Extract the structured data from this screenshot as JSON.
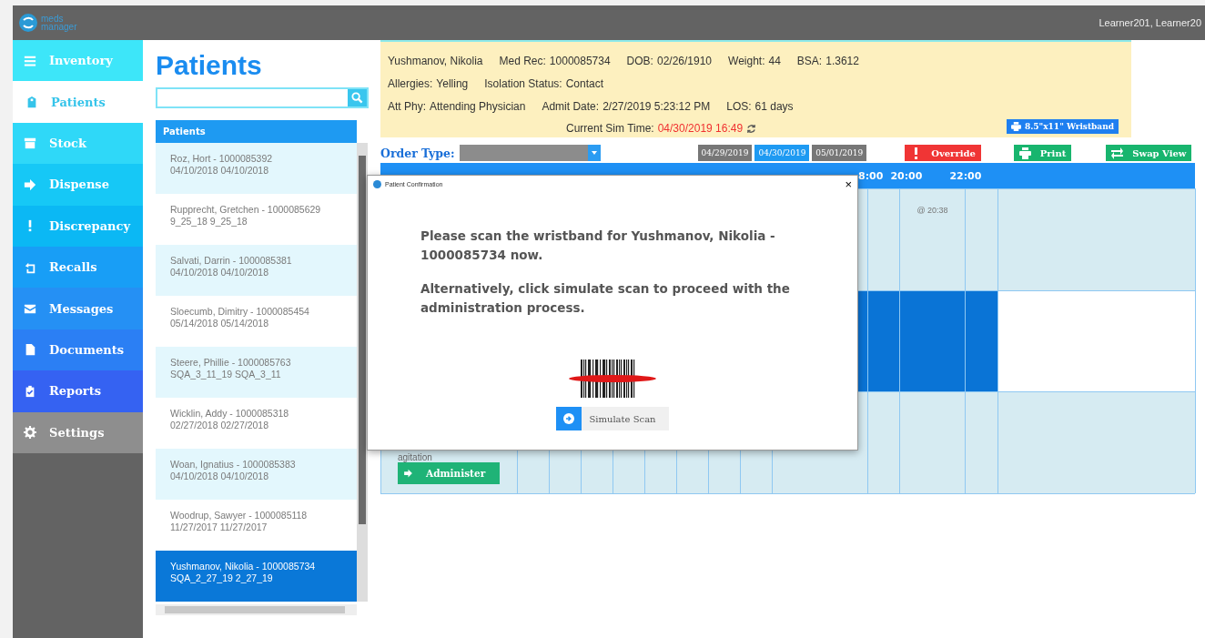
{
  "header": {
    "logo_text": "meds manager",
    "user": "Learner201, Learner20"
  },
  "sidebar": {
    "items": [
      {
        "label": "Inventory",
        "selected": false,
        "color": "#3de6f9"
      },
      {
        "label": "Patients",
        "selected": true,
        "color": "#36c4ea"
      },
      {
        "label": "Stock",
        "selected": false,
        "color": "#2fd8f8"
      },
      {
        "label": "Dispense",
        "selected": false,
        "color": "#16c8f6"
      },
      {
        "label": "Discrepancy",
        "selected": false,
        "color": "#0bb8f4"
      },
      {
        "label": "Recalls",
        "selected": false,
        "color": "#189ef6"
      },
      {
        "label": "Messages",
        "selected": false,
        "color": "#2590f4"
      },
      {
        "label": "Documents",
        "selected": false,
        "color": "#2b7ff4"
      },
      {
        "label": "Reports",
        "selected": false,
        "color": "#3562f2"
      },
      {
        "label": "Settings",
        "selected": false,
        "color": "#8e8e8e"
      }
    ]
  },
  "patients": {
    "title": "Patients",
    "list_header": "Patients",
    "rows": [
      {
        "line1": "Roz, Hort - 1000085392",
        "line2": "04/10/2018 04/10/2018",
        "selected": false
      },
      {
        "line1": "Rupprecht, Gretchen - 1000085629",
        "line2": "9_25_18 9_25_18",
        "selected": false
      },
      {
        "line1": "Salvati, Darrin - 1000085381",
        "line2": "04/10/2018 04/10/2018",
        "selected": false
      },
      {
        "line1": "Sloecumb, Dimitry - 1000085454",
        "line2": "05/14/2018 05/14/2018",
        "selected": false
      },
      {
        "line1": "Steere, Phillie - 1000085763",
        "line2": "SQA_3_11_19 SQA_3_11",
        "selected": false
      },
      {
        "line1": "Wicklin, Addy - 1000085318",
        "line2": "02/27/2018 02/27/2018",
        "selected": false
      },
      {
        "line1": "Woan, Ignatius - 1000085383",
        "line2": "04/10/2018 04/10/2018",
        "selected": false
      },
      {
        "line1": "Woodrup, Sawyer - 1000085118",
        "line2": "11/27/2017 11/27/2017",
        "selected": false
      },
      {
        "line1": "Yushmanov, Nikolia - 1000085734",
        "line2": "SQA_2_27_19 2_27_19",
        "selected": true
      }
    ]
  },
  "patient_info": {
    "lines": [
      [
        {
          "value": "Yushmanov, Nikolia"
        },
        {
          "label": "Med Rec:",
          "value": "1000085734"
        },
        {
          "label": "DOB:",
          "value": "02/26/1910"
        },
        {
          "label": "Weight:",
          "value": "44"
        },
        {
          "label": "BSA:",
          "value": "1.3612"
        }
      ],
      [
        {
          "label": "Allergies:",
          "value": "Yelling"
        },
        {
          "label": "Isolation Status:",
          "value": "Contact"
        }
      ],
      [
        {
          "label": "Att Phy:",
          "value": "Attending Physician"
        },
        {
          "label": "Admit Date:",
          "value": "2/27/2019 5:23:12 PM"
        },
        {
          "label": "LOS:",
          "value": "61 days"
        }
      ]
    ],
    "sim_time": {
      "label": "Current Sim Time:",
      "value": "04/30/2019 16:49"
    },
    "wristband_button": "8.5\"x11\" Wristband"
  },
  "toolbar": {
    "order_type_label": "Order Type:",
    "dates": [
      {
        "label": "04/29/2019",
        "selected": false
      },
      {
        "label": "04/30/2019",
        "selected": true
      },
      {
        "label": "05/01/2019",
        "selected": false
      }
    ],
    "buttons": [
      {
        "kind": "override",
        "label": "Override"
      },
      {
        "kind": "print",
        "label": "Print"
      },
      {
        "kind": "swap",
        "label": "Swap View"
      }
    ]
  },
  "schedule": {
    "time_labels": [
      "8:00",
      "20:00",
      "22:00"
    ],
    "rows": [
      {
        "selected": false,
        "cells": [
          {
            "scheduled": false
          },
          {
            "scheduled": false,
            "note": "@ 20:38"
          },
          {
            "scheduled": false
          }
        ]
      },
      {
        "selected": true,
        "cells": [
          {
            "scheduled": true
          },
          {
            "scheduled": true
          },
          {
            "scheduled": true
          }
        ]
      },
      {
        "selected": false,
        "label": "agitation",
        "action": "Administer",
        "cells": [
          {
            "scheduled": false
          },
          {
            "scheduled": false
          },
          {
            "scheduled": false
          }
        ]
      }
    ]
  },
  "dialog": {
    "title": "Patient Confirmation",
    "close": "×",
    "message": "Please scan the wristband for Yushmanov, Nikolia - 1000085734 now.",
    "message_2": "Alternatively, click simulate scan to proceed with the administration process.",
    "button": "Simulate Scan"
  }
}
